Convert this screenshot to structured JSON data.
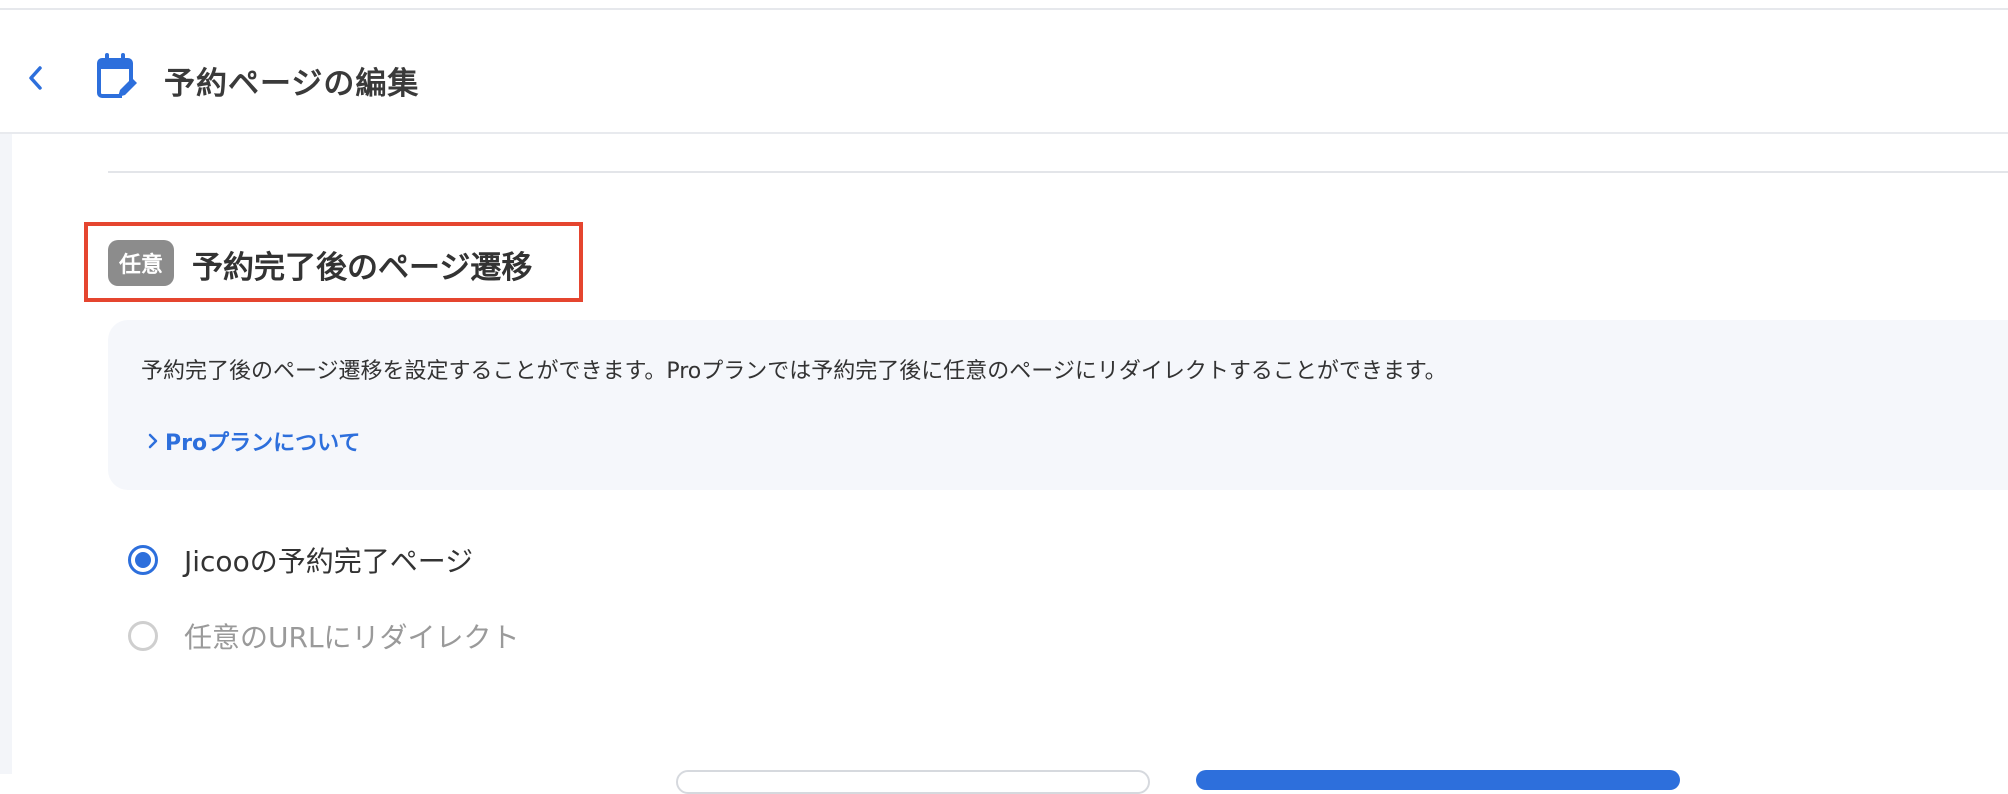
{
  "header": {
    "title": "予約ページの編集"
  },
  "section": {
    "badge": "任意",
    "title": "予約完了後のページ遷移"
  },
  "info": {
    "description": "予約完了後のページ遷移を設定することができます。Proプランでは予約完了後に任意のページにリダイレクトすることができます。",
    "link_label": "Proプランについて"
  },
  "options": [
    {
      "label": "Jicooの予約完了ページ",
      "selected": true
    },
    {
      "label": "任意のURLにリダイレクト",
      "selected": false
    }
  ],
  "icons": {
    "back": "chevron-left-icon",
    "page": "calendar-edit-icon",
    "link": "chevron-right-icon"
  },
  "colors": {
    "accent": "#2d6fdc",
    "highlight": "#e5452f",
    "badge": "#8c8c8c",
    "panel": "#f5f7fb"
  }
}
